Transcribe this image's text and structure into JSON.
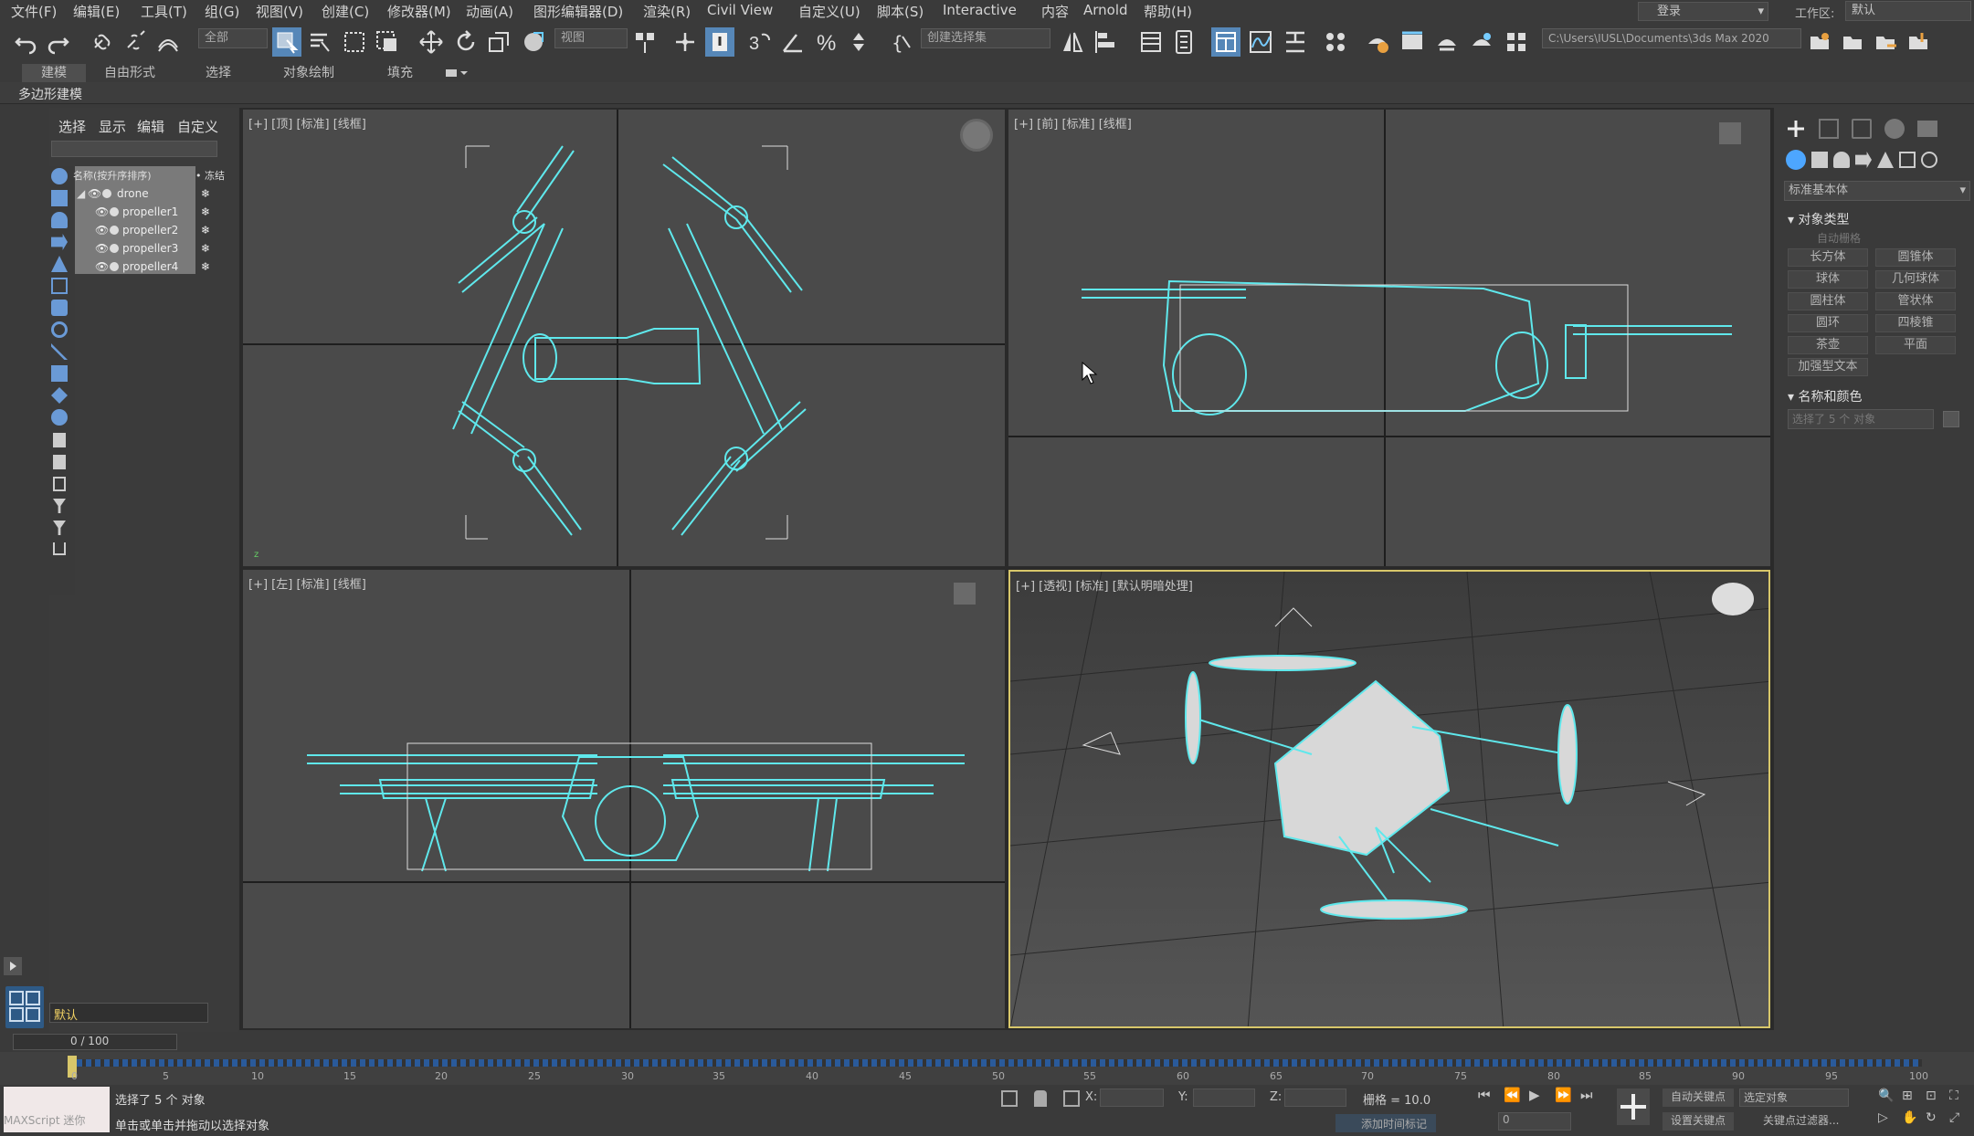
{
  "menu": [
    "文件(F)",
    "编辑(E)",
    "工具(T)",
    "组(G)",
    "视图(V)",
    "创建(C)",
    "修改器(M)",
    "动画(A)",
    "图形编辑器(D)",
    "渲染(R)",
    "Civil View",
    "自定义(U)",
    "脚本(S)",
    "Interactive",
    "内容",
    "Arnold",
    "帮助(H)"
  ],
  "login": "登录",
  "workspace": {
    "label": "工作区:",
    "value": "默认"
  },
  "toolbar": {
    "filter": "全部",
    "view": "视图",
    "selection_set": "创建选择集",
    "project_path": "C:\\Users\\IUSL\\Documents\\3ds Max 2020"
  },
  "ribbon": {
    "tabs": [
      "建模",
      "自由形式",
      "选择",
      "对象绘制",
      "填充"
    ],
    "sub": "多边形建模"
  },
  "scene": {
    "tabs": [
      "选择",
      "显示",
      "编辑",
      "自定义"
    ],
    "header": "名称(按升序排序)",
    "freeze": "• 冻结",
    "rows": [
      "drone",
      "propeller1",
      "propeller2",
      "propeller3",
      "propeller4"
    ],
    "layer": "默认"
  },
  "viewports": {
    "top": "[+] [顶] [标准] [线框]",
    "front": "[+] [前] [标准] [线框]",
    "left": "[+] [左] [标准] [线框]",
    "persp": "[+] [透视] [标准] [默认明暗处理]"
  },
  "command": {
    "category": "标准基本体",
    "rollout1": "对象类型",
    "autogrid": "自动栅格",
    "buttons": [
      "长方体",
      "圆锥体",
      "球体",
      "几何球体",
      "圆柱体",
      "管状体",
      "圆环",
      "四棱锥",
      "茶壶",
      "平面",
      "加强型文本"
    ],
    "rollout2": "名称和颜色",
    "name_field": "选择了 5 个 对象"
  },
  "timeline": {
    "frame": "0 / 100",
    "ticks": [
      "0",
      "5",
      "10",
      "15",
      "20",
      "25",
      "30",
      "35",
      "40",
      "45",
      "50",
      "55",
      "60",
      "65",
      "70",
      "75",
      "80",
      "85",
      "90",
      "95",
      "100"
    ]
  },
  "status": {
    "maxscript": "MAXScript 迷你",
    "selected": "选择了 5 个 对象",
    "prompt": "单击或单击并拖动以选择对象",
    "x": "X:",
    "y": "Y:",
    "z": "Z:",
    "grid": "栅格 = 10.0",
    "add_tag": "添加时间标记",
    "autokey": "自动关键点",
    "setkey": "设置关键点",
    "selected_obj": "选定对象",
    "key_filter": "关键点过滤器...",
    "frame_spin": "0"
  },
  "colors": {
    "accent": "#4da6ff",
    "wire": "#5fe8ec",
    "viewport": "#4a4a4a"
  }
}
